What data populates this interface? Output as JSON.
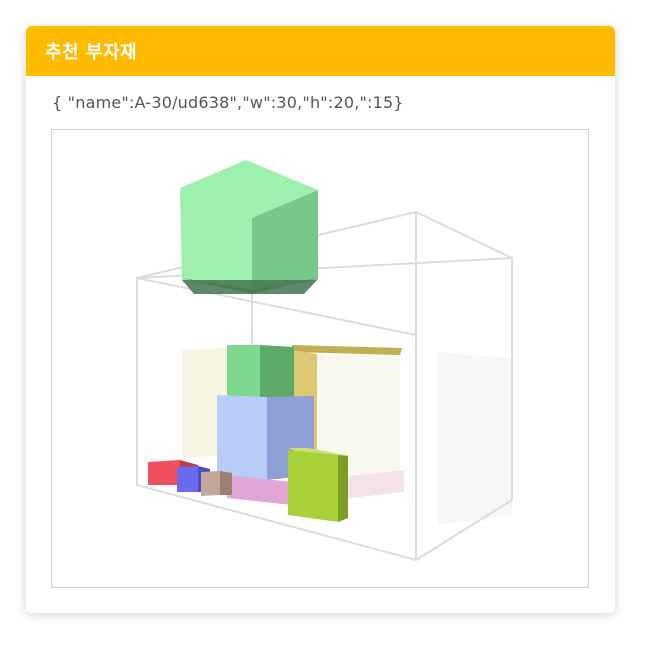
{
  "card": {
    "title": "추천 부자재",
    "json_line": "{ \"name\":A-30/ud638\",\"w\":30,\"h\":20,\":15}"
  },
  "viewer": {
    "description_colors": {
      "header": "#FFBB00",
      "container_edges": "#d9d9d9"
    }
  }
}
